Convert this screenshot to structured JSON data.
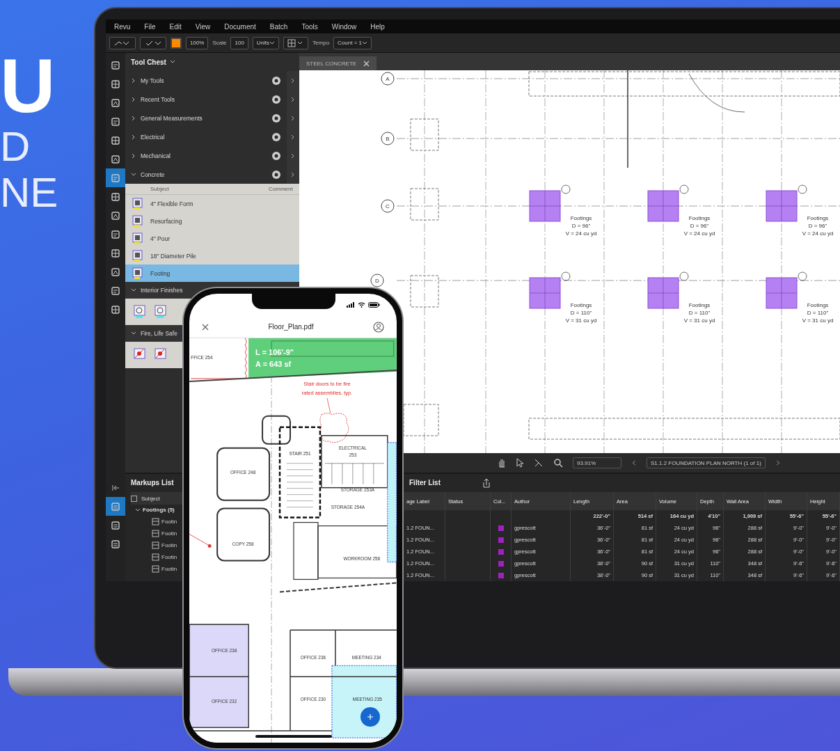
{
  "headline": [
    "U",
    "D",
    "NE"
  ],
  "app": {
    "menu": [
      "Revu",
      "File",
      "Edit",
      "View",
      "Document",
      "Batch",
      "Tools",
      "Window",
      "Help"
    ],
    "toolbar": {
      "zoom": "100%",
      "scale_label": "Scale",
      "scale": "100",
      "units": "Units",
      "tempo_label": "Tempo",
      "count": "Count = 1"
    },
    "side_rail": [
      {
        "selected": false
      },
      {
        "selected": false
      },
      {
        "selected": false
      },
      {
        "selected": false
      },
      {
        "selected": false
      },
      {
        "selected": false
      },
      {
        "selected": true
      },
      {
        "selected": false
      },
      {
        "selected": false
      },
      {
        "selected": false
      },
      {
        "selected": false
      },
      {
        "selected": false
      },
      {
        "selected": false
      },
      {
        "selected": false
      }
    ],
    "side_rail_bottom": [
      {
        "selected": true
      },
      {
        "selected": false
      },
      {
        "selected": false
      }
    ],
    "tool_chest": {
      "title": "Tool Chest",
      "sets": [
        {
          "name": "My Tools",
          "expanded": false
        },
        {
          "name": "Recent Tools",
          "expanded": false
        },
        {
          "name": "General Measurements",
          "expanded": false
        },
        {
          "name": "Electrical",
          "expanded": false
        },
        {
          "name": "Mechanical",
          "expanded": false
        },
        {
          "name": "Concrete",
          "expanded": true
        }
      ],
      "columns": [
        "Subject",
        "Comment"
      ],
      "tools": [
        {
          "subject": "4\" Flexible Form",
          "selected": false
        },
        {
          "subject": "Resurfacing",
          "selected": false
        },
        {
          "subject": "4\" Pour",
          "selected": false
        },
        {
          "subject": "18\" Diameter Pile",
          "selected": false
        },
        {
          "subject": "Footing",
          "selected": true
        }
      ],
      "more_sets": [
        {
          "name": "Interior Finishes",
          "expanded": true
        },
        {
          "name": "Fire, Life Safe",
          "expanded": true
        }
      ]
    },
    "document_tab": "STEEL CONCRETE",
    "drawing": {
      "grid": [
        "A",
        "B",
        "C",
        "D"
      ],
      "footings": [
        {
          "title": "Footings",
          "depth": "D = 96\"",
          "volume": "V = 24 cu yd"
        },
        {
          "title": "Footings",
          "depth": "D = 96\"",
          "volume": "V = 24 cu yd"
        },
        {
          "title": "Footings",
          "depth": "D = 96\"",
          "volume": "V = 24 cu yd"
        },
        {
          "title": "Footings",
          "depth": "D = 110\"",
          "volume": "V = 31 cu yd"
        },
        {
          "title": "Footings",
          "depth": "D = 110\"",
          "volume": "V = 31 cu yd"
        },
        {
          "title": "Footings",
          "depth": "D = 110\"",
          "volume": "V = 31 cu yd"
        }
      ]
    },
    "navigation": {
      "zoom": "93.91%",
      "page": "S1.1.2 FOUNDATION PLAN NORTH (1 of 1)"
    },
    "markups": {
      "title": "Markups List",
      "subject_checked": false,
      "subject_header": "Subject",
      "group": "Footings (5)",
      "items": [
        "Footin",
        "Footin",
        "Footin",
        "Footin",
        "Footin"
      ],
      "filter": "Filter List",
      "columns": [
        "age Label",
        "Status",
        "Col...",
        "Author",
        "Length",
        "Area",
        "Volume",
        "Depth",
        "Wall Area",
        "Width",
        "Height"
      ],
      "totals": [
        "222'-0\"",
        "514 sf",
        "164 cu yd",
        "4'10\"",
        "1,909 sf",
        "55'-6\"",
        "55'-6\""
      ],
      "rows": [
        {
          "page_label": "1.2 FOUN...",
          "color": "#a020c0",
          "author": "gprescott",
          "values": [
            "36'-0\"",
            "81 sf",
            "24 cu yd",
            "96\"",
            "288 sf",
            "9'-0\"",
            "9'-0\""
          ]
        },
        {
          "page_label": "1.2 FOUN...",
          "color": "#a020c0",
          "author": "gprescott",
          "values": [
            "36'-0\"",
            "81 sf",
            "24 cu yd",
            "96\"",
            "288 sf",
            "9'-0\"",
            "9'-0\""
          ]
        },
        {
          "page_label": "1.2 FOUN...",
          "color": "#a020c0",
          "author": "gprescott",
          "values": [
            "36'-0\"",
            "81 sf",
            "24 cu yd",
            "96\"",
            "288 sf",
            "9'-0\"",
            "9'-0\""
          ]
        },
        {
          "page_label": "1.2 FOUN...",
          "color": "#a020c0",
          "author": "gprescott",
          "values": [
            "38'-0\"",
            "90 sf",
            "31 cu yd",
            "110\"",
            "348 sf",
            "9'-6\"",
            "9'-6\""
          ]
        },
        {
          "page_label": "1.2 FOUN...",
          "color": "#a020c0",
          "author": "gprescott",
          "values": [
            "38'-0\"",
            "90 sf",
            "31 cu yd",
            "110\"",
            "348 sf",
            "9'-6\"",
            "9'-6\""
          ]
        }
      ]
    }
  },
  "phone": {
    "file": "Floor_Plan.pdf",
    "measure": [
      "L = 106'-9\"",
      "A = 643 sf"
    ],
    "note": [
      "Stair doors to be fire",
      "rated assemblies, typ."
    ],
    "rooms": [
      {
        "lines": [
          "FFICE 254"
        ]
      },
      {
        "lines": [
          "STAIR 251"
        ]
      },
      {
        "lines": [
          "ELECTRICAL",
          "253"
        ]
      },
      {
        "lines": [
          "OFFICE 248"
        ]
      },
      {
        "lines": [
          "STORAGE 253A"
        ]
      },
      {
        "lines": [
          "STORAGE 254A"
        ]
      },
      {
        "lines": [
          "COPY 258"
        ]
      },
      {
        "lines": [
          "WORKROOM 256"
        ]
      },
      {
        "lines": [
          "OFFICE 238"
        ]
      },
      {
        "lines": [
          "OFFICE 232"
        ]
      },
      {
        "lines": [
          "OFFICE 236"
        ]
      },
      {
        "lines": [
          "MEETING 234"
        ]
      },
      {
        "lines": [
          "OFFICE 230"
        ]
      },
      {
        "lines": [
          "MEETING 235"
        ]
      }
    ]
  }
}
